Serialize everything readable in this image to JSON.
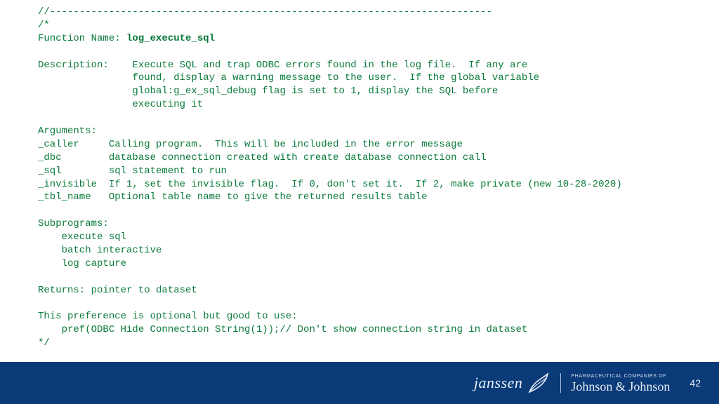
{
  "code": {
    "rule": "//---------------------------------------------------------------------------",
    "open": "/*",
    "fn_label": "Function Name: ",
    "fn_name": "log_execute_sql",
    "desc_l1": "Description:    Execute SQL and trap ODBC errors found in the log file.  If any are",
    "desc_l2": "                found, display a warning message to the user.  If the global variable",
    "desc_l3": "                global:g_ex_sql_debug flag is set to 1, display the SQL before",
    "desc_l4": "                executing it",
    "args_hdr": "Arguments:",
    "arg1": "_caller     Calling program.  This will be included in the error message",
    "arg2": "_dbc        database connection created with create database connection call",
    "arg3": "_sql        sql statement to run",
    "arg4": "_invisible  If 1, set the invisible flag.  If 0, don't set it.  If 2, make private (new 10-28-2020)",
    "arg5": "_tbl_name   Optional table name to give the returned results table",
    "sub_hdr": "Subprograms:",
    "sub1": "    execute sql",
    "sub2": "    batch interactive",
    "sub3": "    log capture",
    "returns": "Returns: pointer to dataset",
    "pref1": "This preference is optional but good to use:",
    "pref2": "    pref(ODBC Hide Connection String(1));// Don't show connection string in dataset",
    "close": "*/"
  },
  "footer": {
    "brand1": "janssen",
    "brand2_small": "pharmaceutical companies of",
    "brand2_script": "Johnson & Johnson",
    "page": "42"
  }
}
